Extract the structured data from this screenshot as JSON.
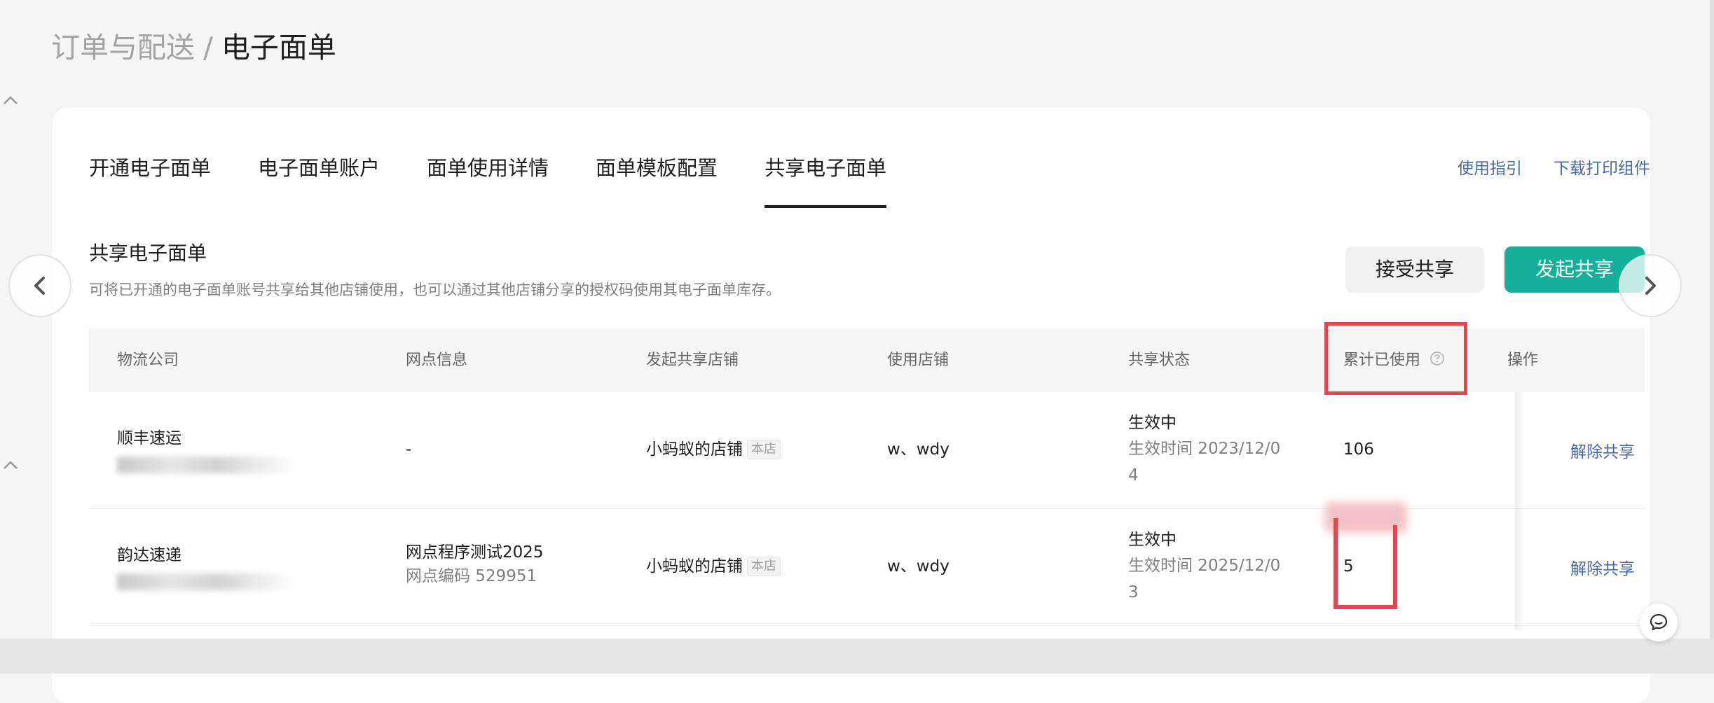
{
  "breadcrumb": {
    "parent": "订单与配送",
    "separator": "/",
    "current": "电子面单"
  },
  "tabs": [
    {
      "label": "开通电子面单",
      "active": false
    },
    {
      "label": "电子面单账户",
      "active": false
    },
    {
      "label": "面单使用详情",
      "active": false
    },
    {
      "label": "面单模板配置",
      "active": false
    },
    {
      "label": "共享电子面单",
      "active": true
    }
  ],
  "header_links": {
    "guide": "使用指引",
    "download": "下载打印组件"
  },
  "section": {
    "title": "共享电子面单",
    "description": "可将已开通的电子面单账号共享给其他店铺使用，也可以通过其他店铺分享的授权码使用其电子面单库存。"
  },
  "actions": {
    "accept_label": "接受共享",
    "initiate_label": "发起共享"
  },
  "table": {
    "columns": [
      "物流公司",
      "网点信息",
      "发起共享店铺",
      "使用店铺",
      "共享状态",
      "累计已使用",
      "操作"
    ],
    "rows": [
      {
        "company": "顺丰速运",
        "outlet_name": "-",
        "outlet_code": "",
        "initiator_shop": "小蚂蚁的店铺",
        "initiator_tag": "本店",
        "user_shop": "w、wdy",
        "status": "生效中",
        "effective_line1": "生效时间 2023/12/0",
        "effective_line2": "4",
        "used": "106",
        "operation": "解除共享"
      },
      {
        "company": "韵达速递",
        "outlet_name": "网点程序测试2025",
        "outlet_code": "网点编码 529951",
        "initiator_shop": "小蚂蚁的店铺",
        "initiator_tag": "本店",
        "user_shop": "w、wdy",
        "status": "生效中",
        "effective_line1": "生效时间 2025/12/0",
        "effective_line2": "3",
        "used": "5",
        "operation": "解除共享"
      }
    ]
  },
  "colors": {
    "primary": "#14b09a",
    "link": "#4a6aa5",
    "highlight": "#e9434e"
  },
  "icons": {
    "help": "question-circle-icon",
    "carousel_prev": "chevron-left-icon",
    "carousel_next": "chevron-right-icon",
    "collapse": "chevron-up-icon",
    "chat": "chat-bubble-icon"
  }
}
